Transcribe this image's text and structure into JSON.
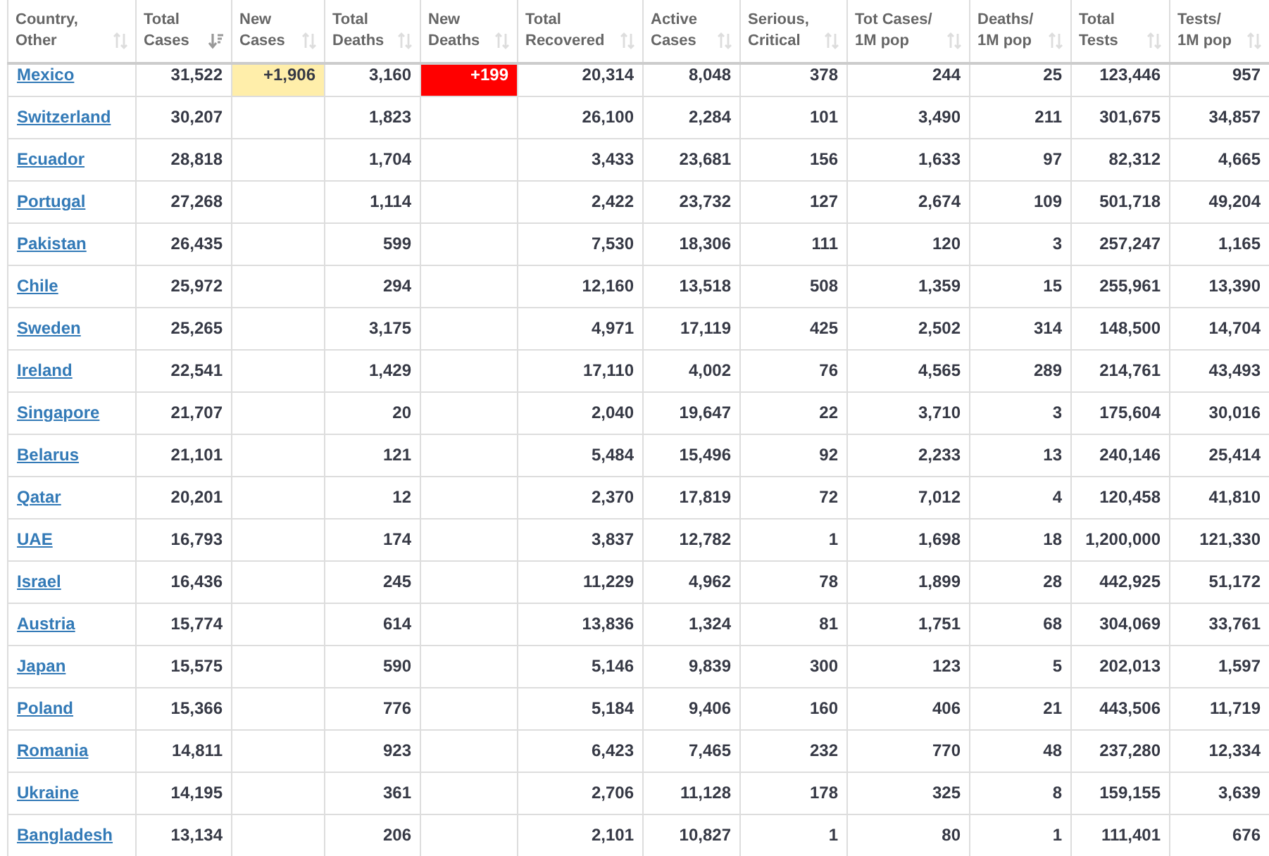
{
  "table": {
    "columns": [
      {
        "label": "Country, Other",
        "sorted": false
      },
      {
        "label": "Total Cases",
        "sorted": true
      },
      {
        "label": "New Cases",
        "sorted": false
      },
      {
        "label": "Total Deaths",
        "sorted": false
      },
      {
        "label": "New Deaths",
        "sorted": false
      },
      {
        "label": "Total Recovered",
        "sorted": false
      },
      {
        "label": "Active Cases",
        "sorted": false
      },
      {
        "label": "Serious, Critical",
        "sorted": false
      },
      {
        "label": "Tot Cases/ 1M pop",
        "sorted": false
      },
      {
        "label": "Deaths/ 1M pop",
        "sorted": false
      },
      {
        "label": "Total Tests",
        "sorted": false
      },
      {
        "label": "Tests/ 1M pop",
        "sorted": false
      }
    ],
    "rows": [
      {
        "country": "Mexico",
        "total_cases": "31,522",
        "new_cases": "+1,906",
        "total_deaths": "3,160",
        "new_deaths": "+199",
        "total_recovered": "20,314",
        "active_cases": "8,048",
        "serious_critical": "378",
        "tot_cases_1m": "244",
        "deaths_1m": "25",
        "total_tests": "123,446",
        "tests_1m": "957"
      },
      {
        "country": "Switzerland",
        "total_cases": "30,207",
        "total_deaths": "1,823",
        "total_recovered": "26,100",
        "active_cases": "2,284",
        "serious_critical": "101",
        "tot_cases_1m": "3,490",
        "deaths_1m": "211",
        "total_tests": "301,675",
        "tests_1m": "34,857"
      },
      {
        "country": "Ecuador",
        "total_cases": "28,818",
        "total_deaths": "1,704",
        "total_recovered": "3,433",
        "active_cases": "23,681",
        "serious_critical": "156",
        "tot_cases_1m": "1,633",
        "deaths_1m": "97",
        "total_tests": "82,312",
        "tests_1m": "4,665"
      },
      {
        "country": "Portugal",
        "total_cases": "27,268",
        "total_deaths": "1,114",
        "total_recovered": "2,422",
        "active_cases": "23,732",
        "serious_critical": "127",
        "tot_cases_1m": "2,674",
        "deaths_1m": "109",
        "total_tests": "501,718",
        "tests_1m": "49,204"
      },
      {
        "country": "Pakistan",
        "total_cases": "26,435",
        "total_deaths": "599",
        "total_recovered": "7,530",
        "active_cases": "18,306",
        "serious_critical": "111",
        "tot_cases_1m": "120",
        "deaths_1m": "3",
        "total_tests": "257,247",
        "tests_1m": "1,165"
      },
      {
        "country": "Chile",
        "total_cases": "25,972",
        "total_deaths": "294",
        "total_recovered": "12,160",
        "active_cases": "13,518",
        "serious_critical": "508",
        "tot_cases_1m": "1,359",
        "deaths_1m": "15",
        "total_tests": "255,961",
        "tests_1m": "13,390"
      },
      {
        "country": "Sweden",
        "total_cases": "25,265",
        "total_deaths": "3,175",
        "total_recovered": "4,971",
        "active_cases": "17,119",
        "serious_critical": "425",
        "tot_cases_1m": "2,502",
        "deaths_1m": "314",
        "total_tests": "148,500",
        "tests_1m": "14,704"
      },
      {
        "country": "Ireland",
        "total_cases": "22,541",
        "total_deaths": "1,429",
        "total_recovered": "17,110",
        "active_cases": "4,002",
        "serious_critical": "76",
        "tot_cases_1m": "4,565",
        "deaths_1m": "289",
        "total_tests": "214,761",
        "tests_1m": "43,493"
      },
      {
        "country": "Singapore",
        "total_cases": "21,707",
        "total_deaths": "20",
        "total_recovered": "2,040",
        "active_cases": "19,647",
        "serious_critical": "22",
        "tot_cases_1m": "3,710",
        "deaths_1m": "3",
        "total_tests": "175,604",
        "tests_1m": "30,016"
      },
      {
        "country": "Belarus",
        "total_cases": "21,101",
        "total_deaths": "121",
        "total_recovered": "5,484",
        "active_cases": "15,496",
        "serious_critical": "92",
        "tot_cases_1m": "2,233",
        "deaths_1m": "13",
        "total_tests": "240,146",
        "tests_1m": "25,414"
      },
      {
        "country": "Qatar",
        "total_cases": "20,201",
        "total_deaths": "12",
        "total_recovered": "2,370",
        "active_cases": "17,819",
        "serious_critical": "72",
        "tot_cases_1m": "7,012",
        "deaths_1m": "4",
        "total_tests": "120,458",
        "tests_1m": "41,810"
      },
      {
        "country": "UAE",
        "total_cases": "16,793",
        "total_deaths": "174",
        "total_recovered": "3,837",
        "active_cases": "12,782",
        "serious_critical": "1",
        "tot_cases_1m": "1,698",
        "deaths_1m": "18",
        "total_tests": "1,200,000",
        "tests_1m": "121,330"
      },
      {
        "country": "Israel",
        "total_cases": "16,436",
        "total_deaths": "245",
        "total_recovered": "11,229",
        "active_cases": "4,962",
        "serious_critical": "78",
        "tot_cases_1m": "1,899",
        "deaths_1m": "28",
        "total_tests": "442,925",
        "tests_1m": "51,172"
      },
      {
        "country": "Austria",
        "total_cases": "15,774",
        "total_deaths": "614",
        "total_recovered": "13,836",
        "active_cases": "1,324",
        "serious_critical": "81",
        "tot_cases_1m": "1,751",
        "deaths_1m": "68",
        "total_tests": "304,069",
        "tests_1m": "33,761"
      },
      {
        "country": "Japan",
        "total_cases": "15,575",
        "total_deaths": "590",
        "total_recovered": "5,146",
        "active_cases": "9,839",
        "serious_critical": "300",
        "tot_cases_1m": "123",
        "deaths_1m": "5",
        "total_tests": "202,013",
        "tests_1m": "1,597"
      },
      {
        "country": "Poland",
        "total_cases": "15,366",
        "total_deaths": "776",
        "total_recovered": "5,184",
        "active_cases": "9,406",
        "serious_critical": "160",
        "tot_cases_1m": "406",
        "deaths_1m": "21",
        "total_tests": "443,506",
        "tests_1m": "11,719"
      },
      {
        "country": "Romania",
        "total_cases": "14,811",
        "total_deaths": "923",
        "total_recovered": "6,423",
        "active_cases": "7,465",
        "serious_critical": "232",
        "tot_cases_1m": "770",
        "deaths_1m": "48",
        "total_tests": "237,280",
        "tests_1m": "12,334"
      },
      {
        "country": "Ukraine",
        "total_cases": "14,195",
        "total_deaths": "361",
        "total_recovered": "2,706",
        "active_cases": "11,128",
        "serious_critical": "178",
        "tot_cases_1m": "325",
        "deaths_1m": "8",
        "total_tests": "159,155",
        "tests_1m": "3,639"
      },
      {
        "country": "Bangladesh",
        "total_cases": "13,134",
        "total_deaths": "206",
        "total_recovered": "2,101",
        "active_cases": "10,827",
        "serious_critical": "1",
        "tot_cases_1m": "80",
        "deaths_1m": "1",
        "total_tests": "111,401",
        "tests_1m": "676"
      }
    ]
  }
}
